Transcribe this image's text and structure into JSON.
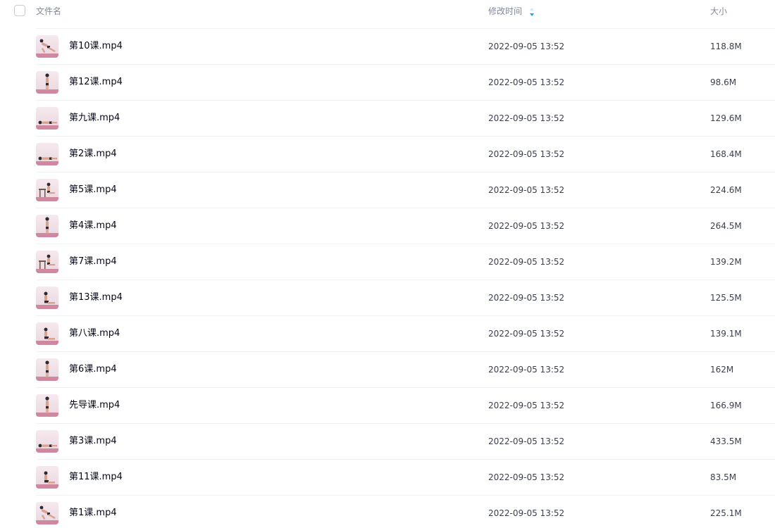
{
  "header": {
    "name_label": "文件名",
    "time_label": "修改时间",
    "size_label": "大小",
    "sort_icon": "sort-arrows-icon",
    "sort_color": "#06a7ff"
  },
  "files": [
    {
      "name": "第10课.mp4",
      "modified": "2022-09-05 13:52",
      "size": "118.8M"
    },
    {
      "name": "第12课.mp4",
      "modified": "2022-09-05 13:52",
      "size": "98.6M"
    },
    {
      "name": "第九课.mp4",
      "modified": "2022-09-05 13:52",
      "size": "129.6M"
    },
    {
      "name": "第2课.mp4",
      "modified": "2022-09-05 13:52",
      "size": "168.4M"
    },
    {
      "name": "第5课.mp4",
      "modified": "2022-09-05 13:52",
      "size": "224.6M"
    },
    {
      "name": "第4课.mp4",
      "modified": "2022-09-05 13:52",
      "size": "264.5M"
    },
    {
      "name": "第7课.mp4",
      "modified": "2022-09-05 13:52",
      "size": "139.2M"
    },
    {
      "name": "第13课.mp4",
      "modified": "2022-09-05 13:52",
      "size": "125.5M"
    },
    {
      "name": "第八课.mp4",
      "modified": "2022-09-05 13:52",
      "size": "139.1M"
    },
    {
      "name": "第6课.mp4",
      "modified": "2022-09-05 13:52",
      "size": "162M"
    },
    {
      "name": "先导课.mp4",
      "modified": "2022-09-05 13:52",
      "size": "166.9M"
    },
    {
      "name": "第3课.mp4",
      "modified": "2022-09-05 13:52",
      "size": "433.5M"
    },
    {
      "name": "第11课.mp4",
      "modified": "2022-09-05 13:52",
      "size": "83.5M"
    },
    {
      "name": "第1课.mp4",
      "modified": "2022-09-05 13:52",
      "size": "225.1M"
    }
  ]
}
